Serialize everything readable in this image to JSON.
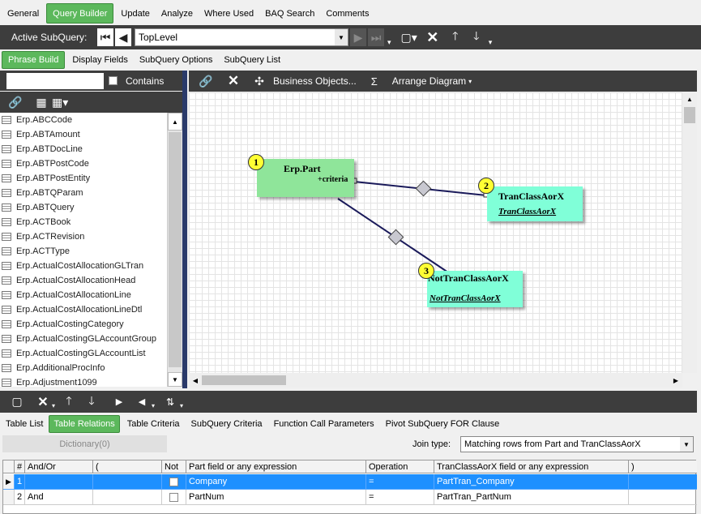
{
  "main_tabs": [
    {
      "label": "General",
      "active": false
    },
    {
      "label": "Query Builder",
      "active": true
    },
    {
      "label": "Update",
      "active": false
    },
    {
      "label": "Analyze",
      "active": false
    },
    {
      "label": "Where Used",
      "active": false
    },
    {
      "label": "BAQ Search",
      "active": false
    },
    {
      "label": "Comments",
      "active": false
    }
  ],
  "subquery_bar": {
    "label": "Active SubQuery:",
    "value": "TopLevel"
  },
  "sub_tabs": [
    {
      "label": "Phrase Build",
      "active": true
    },
    {
      "label": "Display Fields",
      "active": false
    },
    {
      "label": "SubQuery Options",
      "active": false
    },
    {
      "label": "SubQuery List",
      "active": false
    }
  ],
  "search": {
    "value": "",
    "contains_label": "Contains"
  },
  "table_list": [
    "Erp.ABCCode",
    "Erp.ABTAmount",
    "Erp.ABTDocLine",
    "Erp.ABTPostCode",
    "Erp.ABTPostEntity",
    "Erp.ABTQParam",
    "Erp.ABTQuery",
    "Erp.ACTBook",
    "Erp.ACTRevision",
    "Erp.ACTType",
    "Erp.ActualCostAllocationGLTran",
    "Erp.ActualCostAllocationHead",
    "Erp.ActualCostAllocationLine",
    "Erp.ActualCostAllocationLineDtl",
    "Erp.ActualCostingCategory",
    "Erp.ActualCostingGLAccountGroup",
    "Erp.ActualCostingGLAccountList",
    "Erp.AdditionalProcInfo",
    "Erp.Adjustment1099"
  ],
  "diagram_toolbar": {
    "business_objects": "Business Objects...",
    "sigma": "Σ",
    "arrange": "Arrange Diagram"
  },
  "diagram": {
    "nodes": [
      {
        "num": "1",
        "title": "Erp.Part",
        "sub": "+criteria",
        "color": "#8fe59a"
      },
      {
        "num": "2",
        "title": "TranClassAorX",
        "sub": "TranClassAorX",
        "color": "#80ffd8"
      },
      {
        "num": "3",
        "title": "NotTranClassAorX",
        "sub": "NotTranClassAorX",
        "color": "#80ffd8"
      }
    ]
  },
  "bottom_tabs": [
    {
      "label": "Table List",
      "active": false
    },
    {
      "label": "Table Relations",
      "active": true
    },
    {
      "label": "Table Criteria",
      "active": false
    },
    {
      "label": "SubQuery Criteria",
      "active": false
    },
    {
      "label": "Function Call Parameters",
      "active": false
    },
    {
      "label": "Pivot SubQuery FOR Clause",
      "active": false
    }
  ],
  "relations": {
    "dictionary_btn": "Dictionary(0)",
    "join_label": "Join type:",
    "join_value": "Matching rows from Part and TranClassAorX",
    "columns": [
      "#",
      "And/Or",
      "(",
      "Not",
      "Part field or any expression",
      "Operation",
      "TranClassAorX field or any expression",
      ")"
    ],
    "rows": [
      {
        "num": "1",
        "andor": "",
        "paren": "",
        "field": "Company",
        "op": "=",
        "target": "PartTran_Company",
        "close": ""
      },
      {
        "num": "2",
        "andor": "And",
        "paren": "",
        "field": "PartNum",
        "op": "=",
        "target": "PartTran_PartNum",
        "close": ""
      }
    ]
  }
}
